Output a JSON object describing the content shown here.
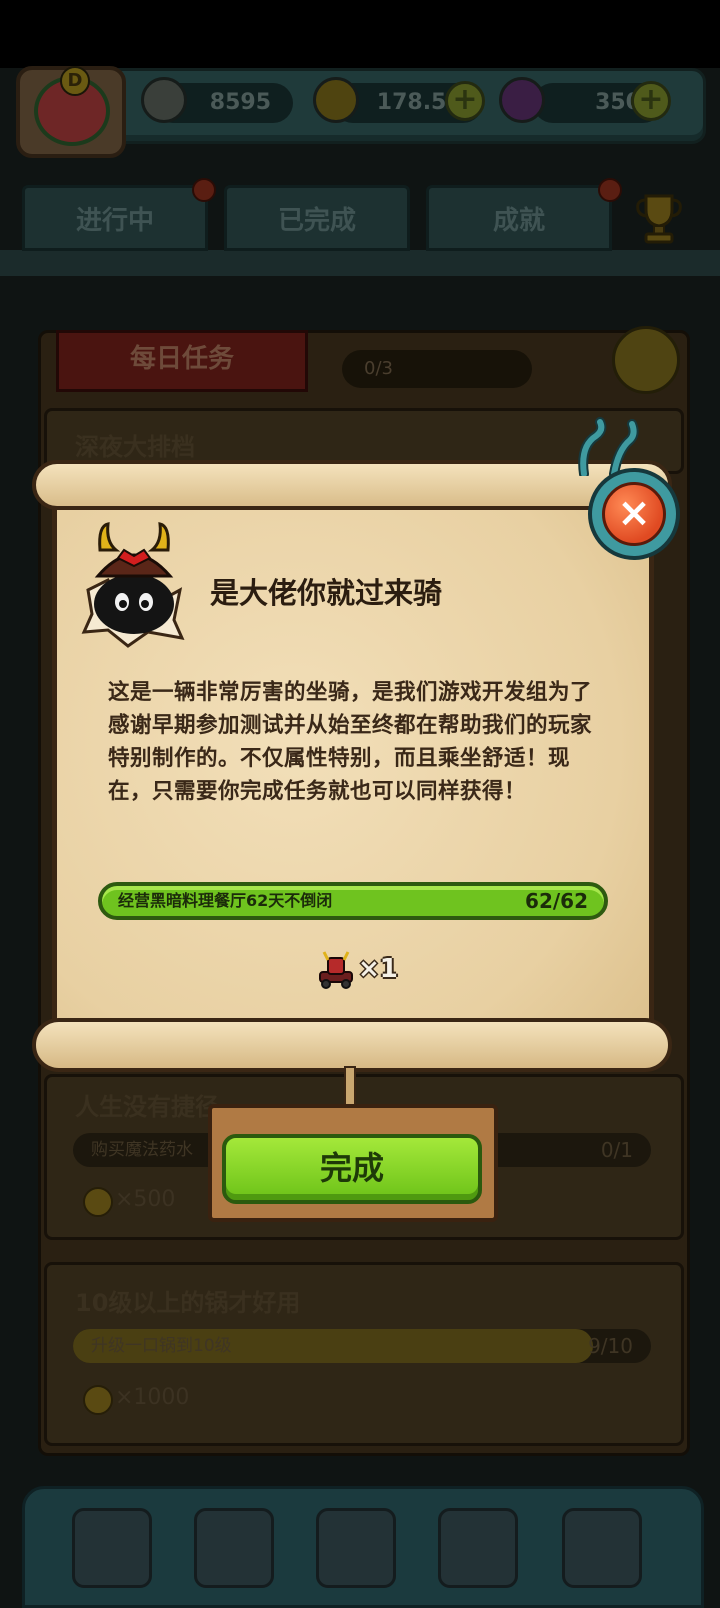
{
  "resources": {
    "eyes": "8595",
    "coins": "178.5k",
    "potions": "350",
    "plus_glyph": "+"
  },
  "player": {
    "level_letter": "D"
  },
  "tabs": [
    {
      "label": "进行中"
    },
    {
      "label": "已完成"
    },
    {
      "label": "成就"
    }
  ],
  "background": {
    "daily_banner": "每日任务",
    "daily_progress": "0/3",
    "quests": [
      {
        "title": "深夜大排档"
      },
      {
        "title": "人生没有捷径",
        "task": "购买魔法药水",
        "count": "0/1",
        "reward": "×500"
      },
      {
        "title": "10级以上的锅才好用",
        "task": "升级一口锅到10级",
        "count": "9/10",
        "reward": "×1000"
      }
    ]
  },
  "modal": {
    "close_glyph": "×",
    "title": "是大佬你就过来骑",
    "description": "这是一辆非常厉害的坐骑，是我们游戏开发组为了感谢早期参加测试并从始至终都在帮助我们的玩家特别制作的。不仅属性特别，而且乘坐舒适！现在，只需要你完成任务就也可以同样获得！",
    "requirement": {
      "label": "经营黑暗料理餐厅62天不倒闭",
      "count": "62/62",
      "progress": 1.0
    },
    "reward_qty": "×1",
    "complete_label": "完成"
  },
  "colors": {
    "progress_green": "#6fc31f",
    "button_green": "#8ad62a",
    "close_red": "#e04a22"
  },
  "icons": [
    "eyeball-icon",
    "coin-icon",
    "potion-icon",
    "trophy-icon",
    "refresh-icon",
    "samurai-hero-icon",
    "mount-reward-icon",
    "close-icon"
  ]
}
